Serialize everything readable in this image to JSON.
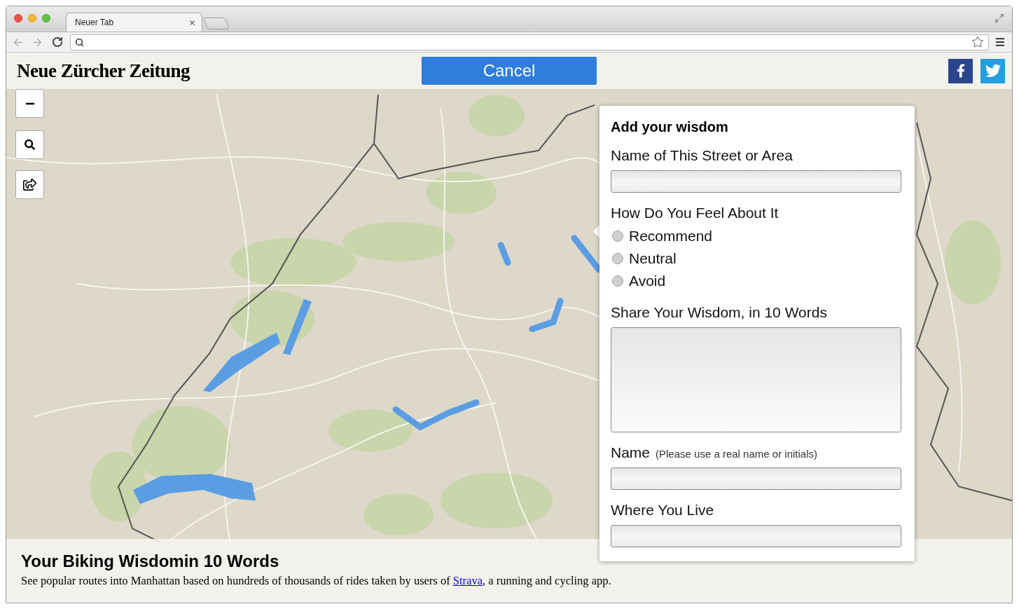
{
  "browser": {
    "tabs": [
      {
        "title": "Neuer Tab",
        "selected": true
      }
    ],
    "back": {
      "disabled": true
    },
    "forward": {
      "disabled": true
    }
  },
  "header": {
    "logo": "Neue Zürcher Zeitung",
    "cancel_button": "Cancel"
  },
  "form": {
    "title": "Add your wisdom",
    "fields": [
      {
        "kind": "text",
        "label": "Name of This Street or Area"
      },
      {
        "kind": "radio",
        "label": "How Do You Feel About It",
        "options": [
          {
            "label": "Recommend",
            "selected": false
          },
          {
            "label": "Neutral",
            "selected": false
          },
          {
            "label": "Avoid",
            "selected": false
          }
        ]
      },
      {
        "kind": "textarea",
        "label": "Share Your Wisdom, in 10 Words"
      },
      {
        "kind": "text",
        "label": "Name",
        "hint": "(Please use a real name or initials)"
      },
      {
        "kind": "text",
        "label": "Where You Live"
      }
    ]
  },
  "footer": {
    "title": "Your Biking Wisdomin 10 Words",
    "description_before": "See popular routes into Manhattan based on hundreds of thousands of rides taken by users of ",
    "link": "Strava",
    "description_after": ", a running and cycling app."
  }
}
